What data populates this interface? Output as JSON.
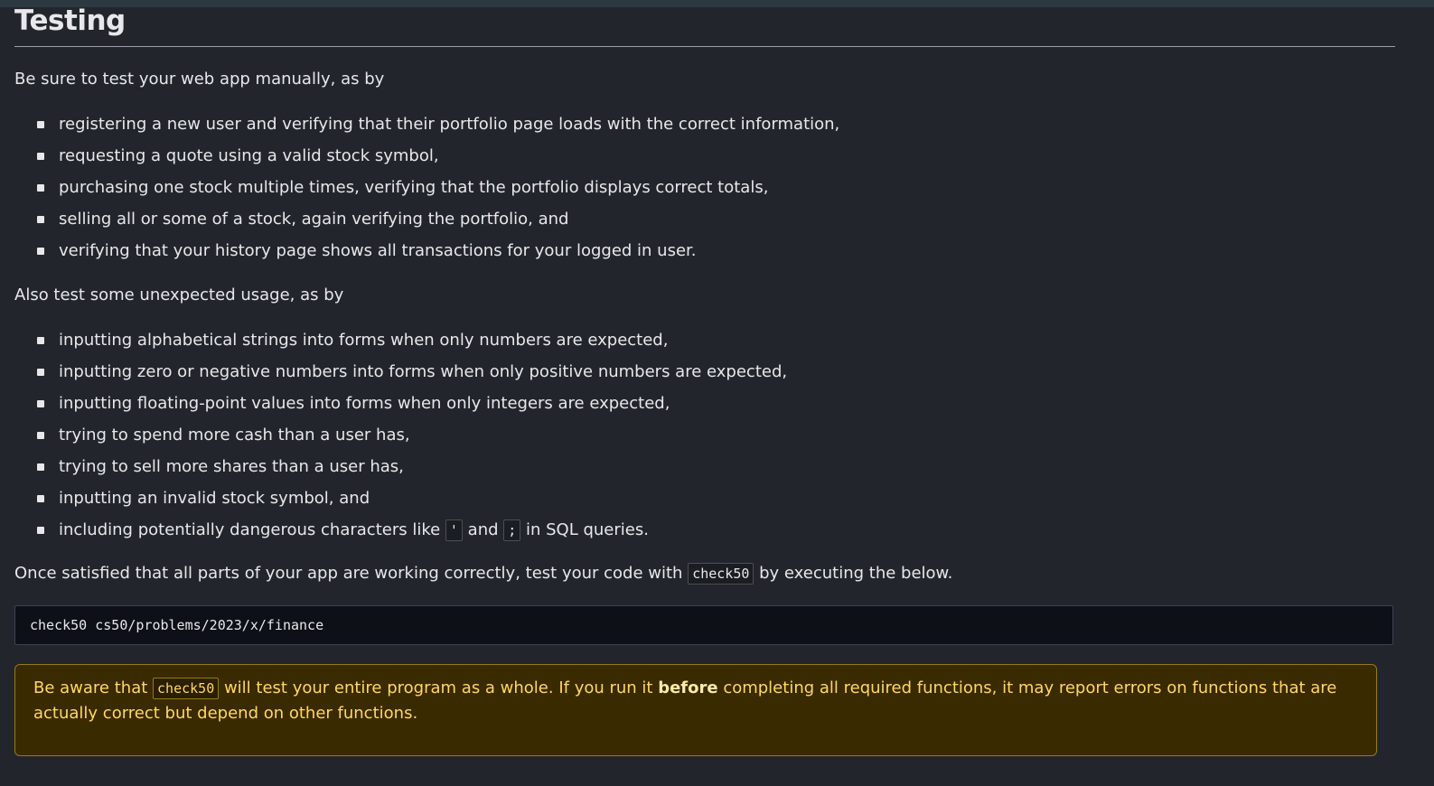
{
  "section": {
    "title": "Testing"
  },
  "manual_testing": {
    "intro": "Be sure to test your web app manually, as by",
    "items": [
      "registering a new user and verifying that their portfolio page loads with the correct information,",
      "requesting a quote using a valid stock symbol,",
      "purchasing one stock multiple times, verifying that the portfolio displays correct totals,",
      "selling all or some of a stock, again verifying the portfolio, and",
      "verifying that your history page shows all transactions for your logged in user."
    ]
  },
  "unexpected_testing": {
    "intro": "Also test some unexpected usage, as by",
    "items": [
      "inputting alphabetical strings into forms when only numbers are expected,",
      "inputting zero or negative numbers into forms when only positive numbers are expected,",
      "inputting floating-point values into forms when only integers are expected,",
      "trying to spend more cash than a user has,",
      "trying to sell more shares than a user has,",
      "inputting an invalid stock symbol, and"
    ],
    "last_item": {
      "before": "including potentially dangerous characters like ",
      "code1": "'",
      "middle": " and ",
      "code2": ";",
      "after": " in SQL queries."
    }
  },
  "check50": {
    "before": "Once satisfied that all parts of your app are working correctly, test your code with ",
    "code": "check50",
    "after": " by executing the below.",
    "command": "check50 cs50/problems/2023/x/finance"
  },
  "warning": {
    "before": "Be aware that ",
    "code": "check50",
    "middle": " will test your entire program as a whole. If you run it ",
    "bold": "before",
    "after": " completing all required functions, it may report errors on functions that are actually correct but depend on other functions."
  }
}
